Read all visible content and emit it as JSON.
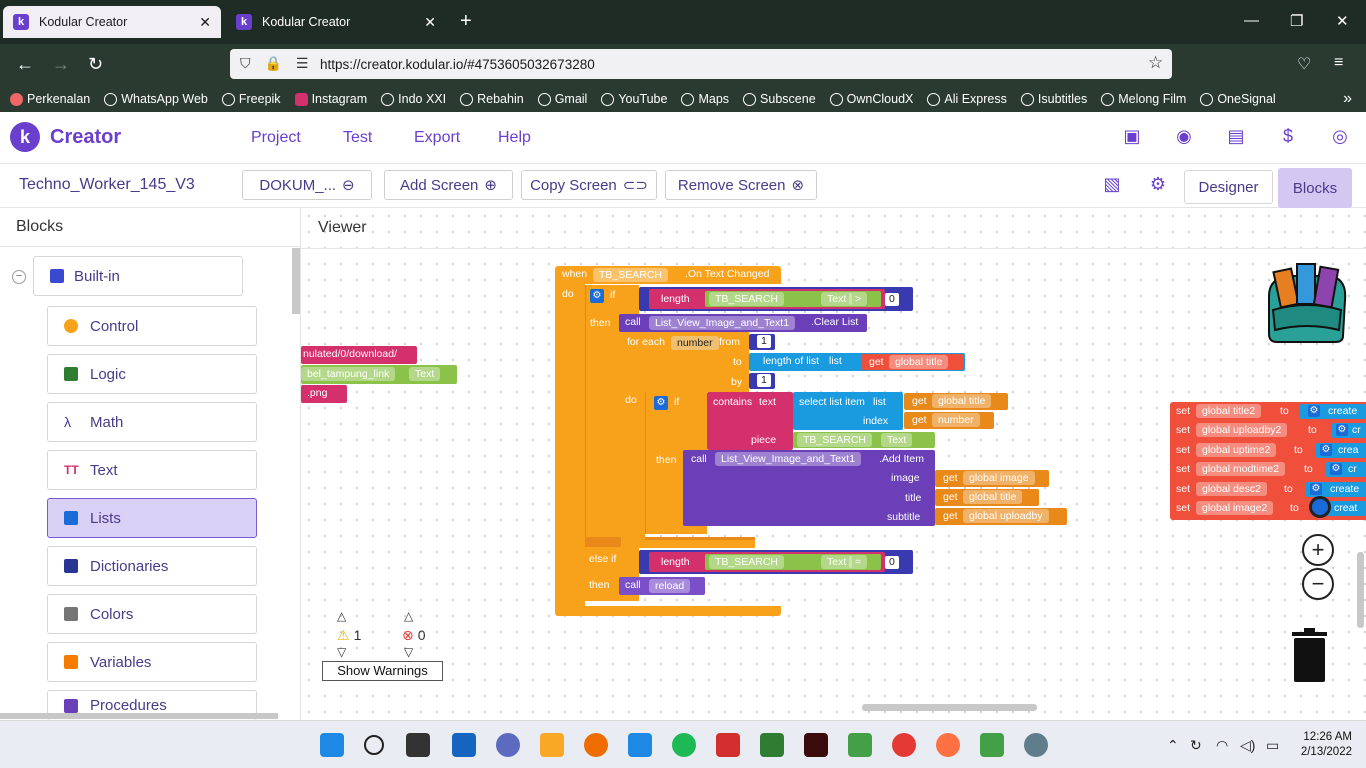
{
  "browser": {
    "tabs": [
      {
        "title": "Kodular Creator",
        "active": true
      },
      {
        "title": "Kodular Creator",
        "active": false
      }
    ],
    "url": "https://creator.kodular.io/#4753605032673280",
    "bookmarks": [
      "Perkenalan",
      "WhatsApp Web",
      "Freepik",
      "Instagram",
      "Indo XXI",
      "Rebahin",
      "Gmail",
      "YouTube",
      "Maps",
      "Subscene",
      "OwnCloudX",
      "Ali Express",
      "Isubtitles",
      "Melong Film",
      "OneSignal"
    ]
  },
  "app": {
    "brand": "Creator",
    "logo_letter": "k",
    "menu": [
      "Project",
      "Test",
      "Export",
      "Help"
    ],
    "project_name": "Techno_Worker_145_V3",
    "screen_select": "DOKUM_...",
    "add_screen": "Add Screen",
    "copy_screen": "Copy Screen",
    "remove_screen": "Remove Screen",
    "designer": "Designer",
    "blocks_btn": "Blocks",
    "accent": "#6a3fce"
  },
  "blocks_panel": {
    "title": "Blocks",
    "builtin": "Built-in",
    "categories": [
      "Control",
      "Logic",
      "Math",
      "Text",
      "Lists",
      "Dictionaries",
      "Colors",
      "Variables",
      "Procedures"
    ],
    "selected": "Lists"
  },
  "viewer": {
    "title": "Viewer",
    "warnings": "1",
    "errors": "0",
    "show_warnings": "Show Warnings",
    "left_fragments": [
      "nulated/0/download/",
      "bel_tampung_link",
      "Text",
      ".png"
    ],
    "event": {
      "when": "when",
      "component": "TB_SEARCH",
      "event_name": ".On Text Changed",
      "do": "do"
    },
    "if1": {
      "if": "if",
      "length": "length",
      "comp": "TB_SEARCH",
      "prop": "Text",
      "op": ">",
      "value": "0"
    },
    "then": "then",
    "call_clear": {
      "call": "call",
      "comp": "List_View_Image_and_Text1",
      "method": ".Clear List"
    },
    "foreach": {
      "label": "for each",
      "var": "number",
      "from": "from",
      "from_val": "1",
      "to": "to",
      "length_of_list": "length of list",
      "list": "list",
      "get": "get",
      "global_title": "global title",
      "by": "by",
      "by_val": "1"
    },
    "inner_if": {
      "if": "if",
      "contains": "contains",
      "text": "text",
      "select_item": "select list item",
      "list": "list",
      "get": "get",
      "global_title": "global title",
      "index": "index",
      "number": "number",
      "piece": "piece",
      "comp": "TB_SEARCH",
      "prop": "Text"
    },
    "add_item": {
      "call": "call",
      "comp": "List_View_Image_and_Text1",
      "method": ".Add Item",
      "image": "image",
      "get": "get",
      "global_image": "global image",
      "title": "title",
      "global_title": "global title",
      "subtitle": "subtitle",
      "global_uploadby": "global uploadby"
    },
    "elseif": {
      "label": "else if",
      "length": "length",
      "comp": "TB_SEARCH",
      "prop": "Text",
      "op": "=",
      "value": "0"
    },
    "call_reload": {
      "call": "call",
      "proc": "reload"
    },
    "set_blocks": [
      {
        "set": "set",
        "var": "global title2",
        "to": "to",
        "val": "create"
      },
      {
        "set": "set",
        "var": "global uploadby2",
        "to": "to",
        "val": "cr"
      },
      {
        "set": "set",
        "var": "global uptime2",
        "to": "to",
        "val": "crea"
      },
      {
        "set": "set",
        "var": "global modtime2",
        "to": "to",
        "val": "cr"
      },
      {
        "set": "set",
        "var": "global desc2",
        "to": "to",
        "val": "create"
      },
      {
        "set": "set",
        "var": "global image2",
        "to": "to",
        "val": "creat"
      }
    ]
  },
  "taskbar": {
    "time": "12:26 AM",
    "date": "2/13/2022"
  }
}
